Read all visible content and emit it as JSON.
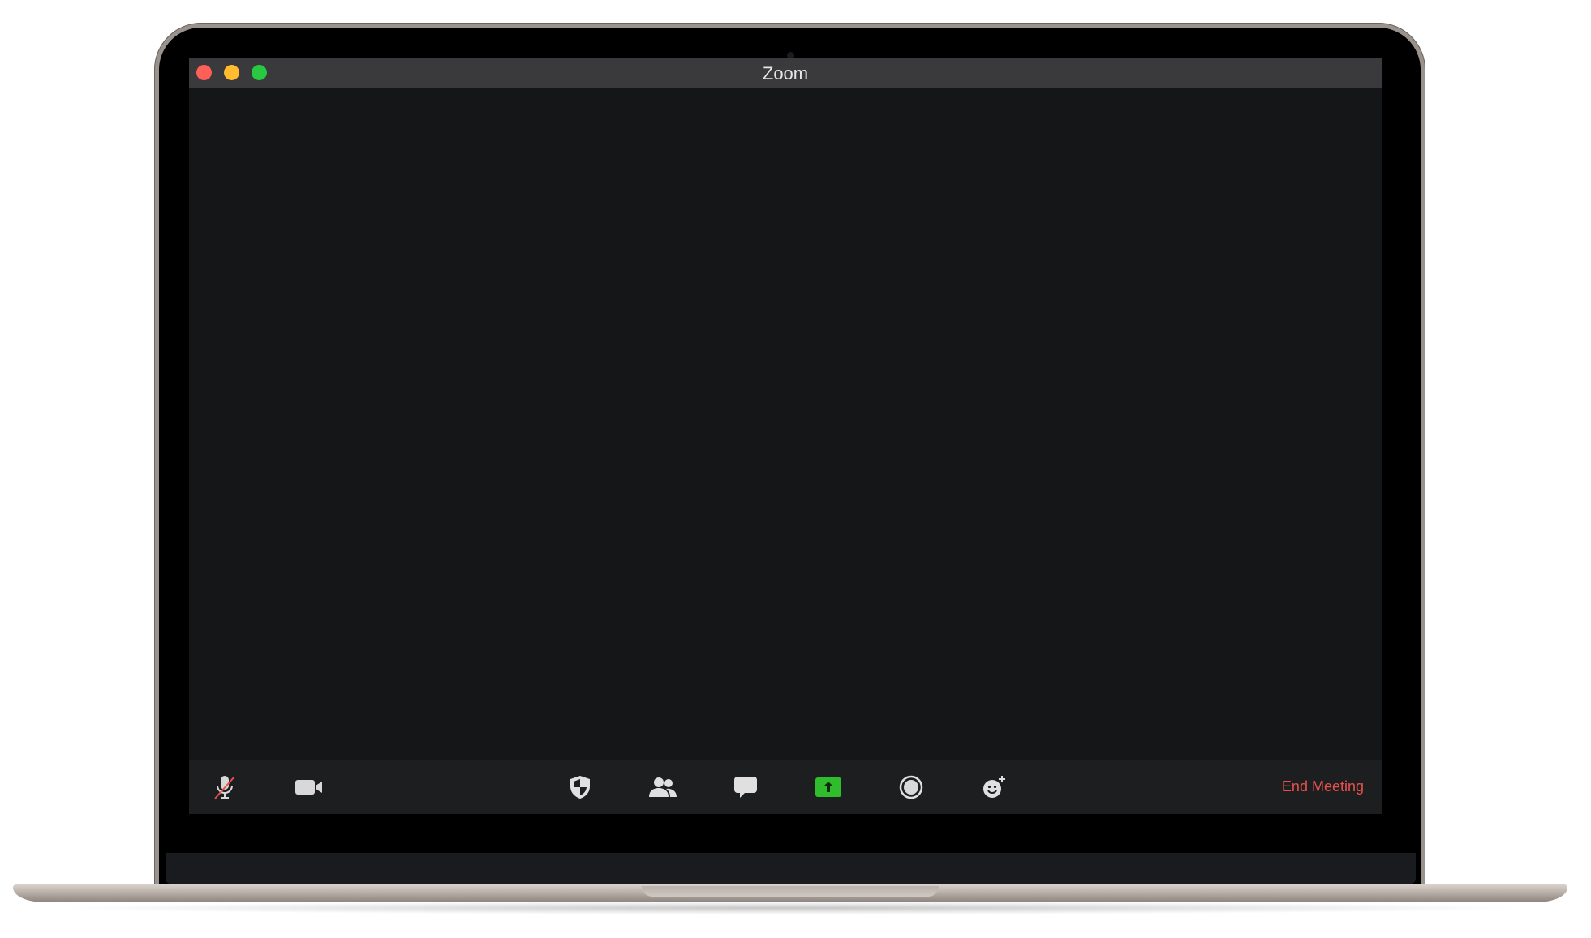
{
  "window": {
    "title": "Zoom"
  },
  "toolbar": {
    "buttons": [
      {
        "name": "mute-microphone",
        "icon": "microphone-muted-icon"
      },
      {
        "name": "video",
        "icon": "video-camera-icon"
      },
      {
        "name": "security",
        "icon": "shield-icon"
      },
      {
        "name": "participants",
        "icon": "participants-icon"
      },
      {
        "name": "chat",
        "icon": "chat-bubble-icon"
      },
      {
        "name": "share-screen",
        "icon": "share-screen-icon"
      },
      {
        "name": "record",
        "icon": "record-icon"
      },
      {
        "name": "reactions",
        "icon": "reaction-emoji-icon"
      }
    ],
    "end_meeting_label": "End Meeting"
  },
  "colors": {
    "window_background": "#151618",
    "titlebar": "#3a3a3c",
    "toolbar": "#1c1e20",
    "share_accent": "#2fbd2c",
    "end_meeting": "#e8504b",
    "traffic_close": "#fe5f57",
    "traffic_minimize": "#febc2e",
    "traffic_maximize": "#28c840"
  }
}
